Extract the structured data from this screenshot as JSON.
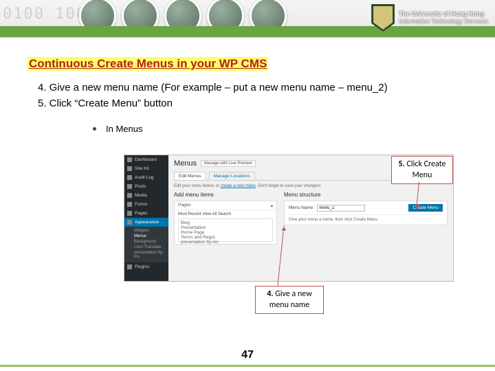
{
  "header": {
    "binary_decor": "0100      10001",
    "org_line1": "The University of Hong Kong",
    "org_line2": "Information Technology Services"
  },
  "title": "Continuous Create Menus in your WP CMS",
  "steps": {
    "s4": "4. Give a new menu name (For example – put a new menu name – menu_2)",
    "s5": "5. Click “Create Menu” button"
  },
  "bullet": "In Menus",
  "wp": {
    "sidebar": {
      "items": [
        "Dashboard",
        "Site Kit",
        "Audit Log",
        "Posts",
        "Media",
        "Forms",
        "Pages",
        "Appearance"
      ],
      "sub": [
        "Widgets",
        "Menus",
        "Background",
        "Loco Translate",
        "presentation fly-ins"
      ],
      "below": [
        "Plugins"
      ]
    },
    "main": {
      "h1": "Menus",
      "manage_btn": "Manage with Live Preview",
      "tab_edit": "Edit Menus",
      "tab_manage": "Manage Locations",
      "hint_pre": "Edit your menu below, or ",
      "hint_link": "create a new menu",
      "hint_post": ". Don't forget to save your changes!",
      "left_h": "Add menu items",
      "right_h": "Menu structure",
      "pages_label": "Pages",
      "tabs_links": "Most Recent   View All   Search",
      "page_items": [
        "Blog",
        "Presentation",
        "Home Page",
        "Terms and Regul.",
        "presentation fly-ins"
      ],
      "menu_name_label": "Menu Name",
      "menu_name_value": "menu_2",
      "create_btn": "Create Menu",
      "struct_hint": "Give your menu a name, then click Create Menu."
    }
  },
  "callouts": {
    "c5_num": "5.",
    "c5_text": "Click Create Menu",
    "c4_num": "4.",
    "c4_text": "Give a new menu name"
  },
  "page_number": "47"
}
